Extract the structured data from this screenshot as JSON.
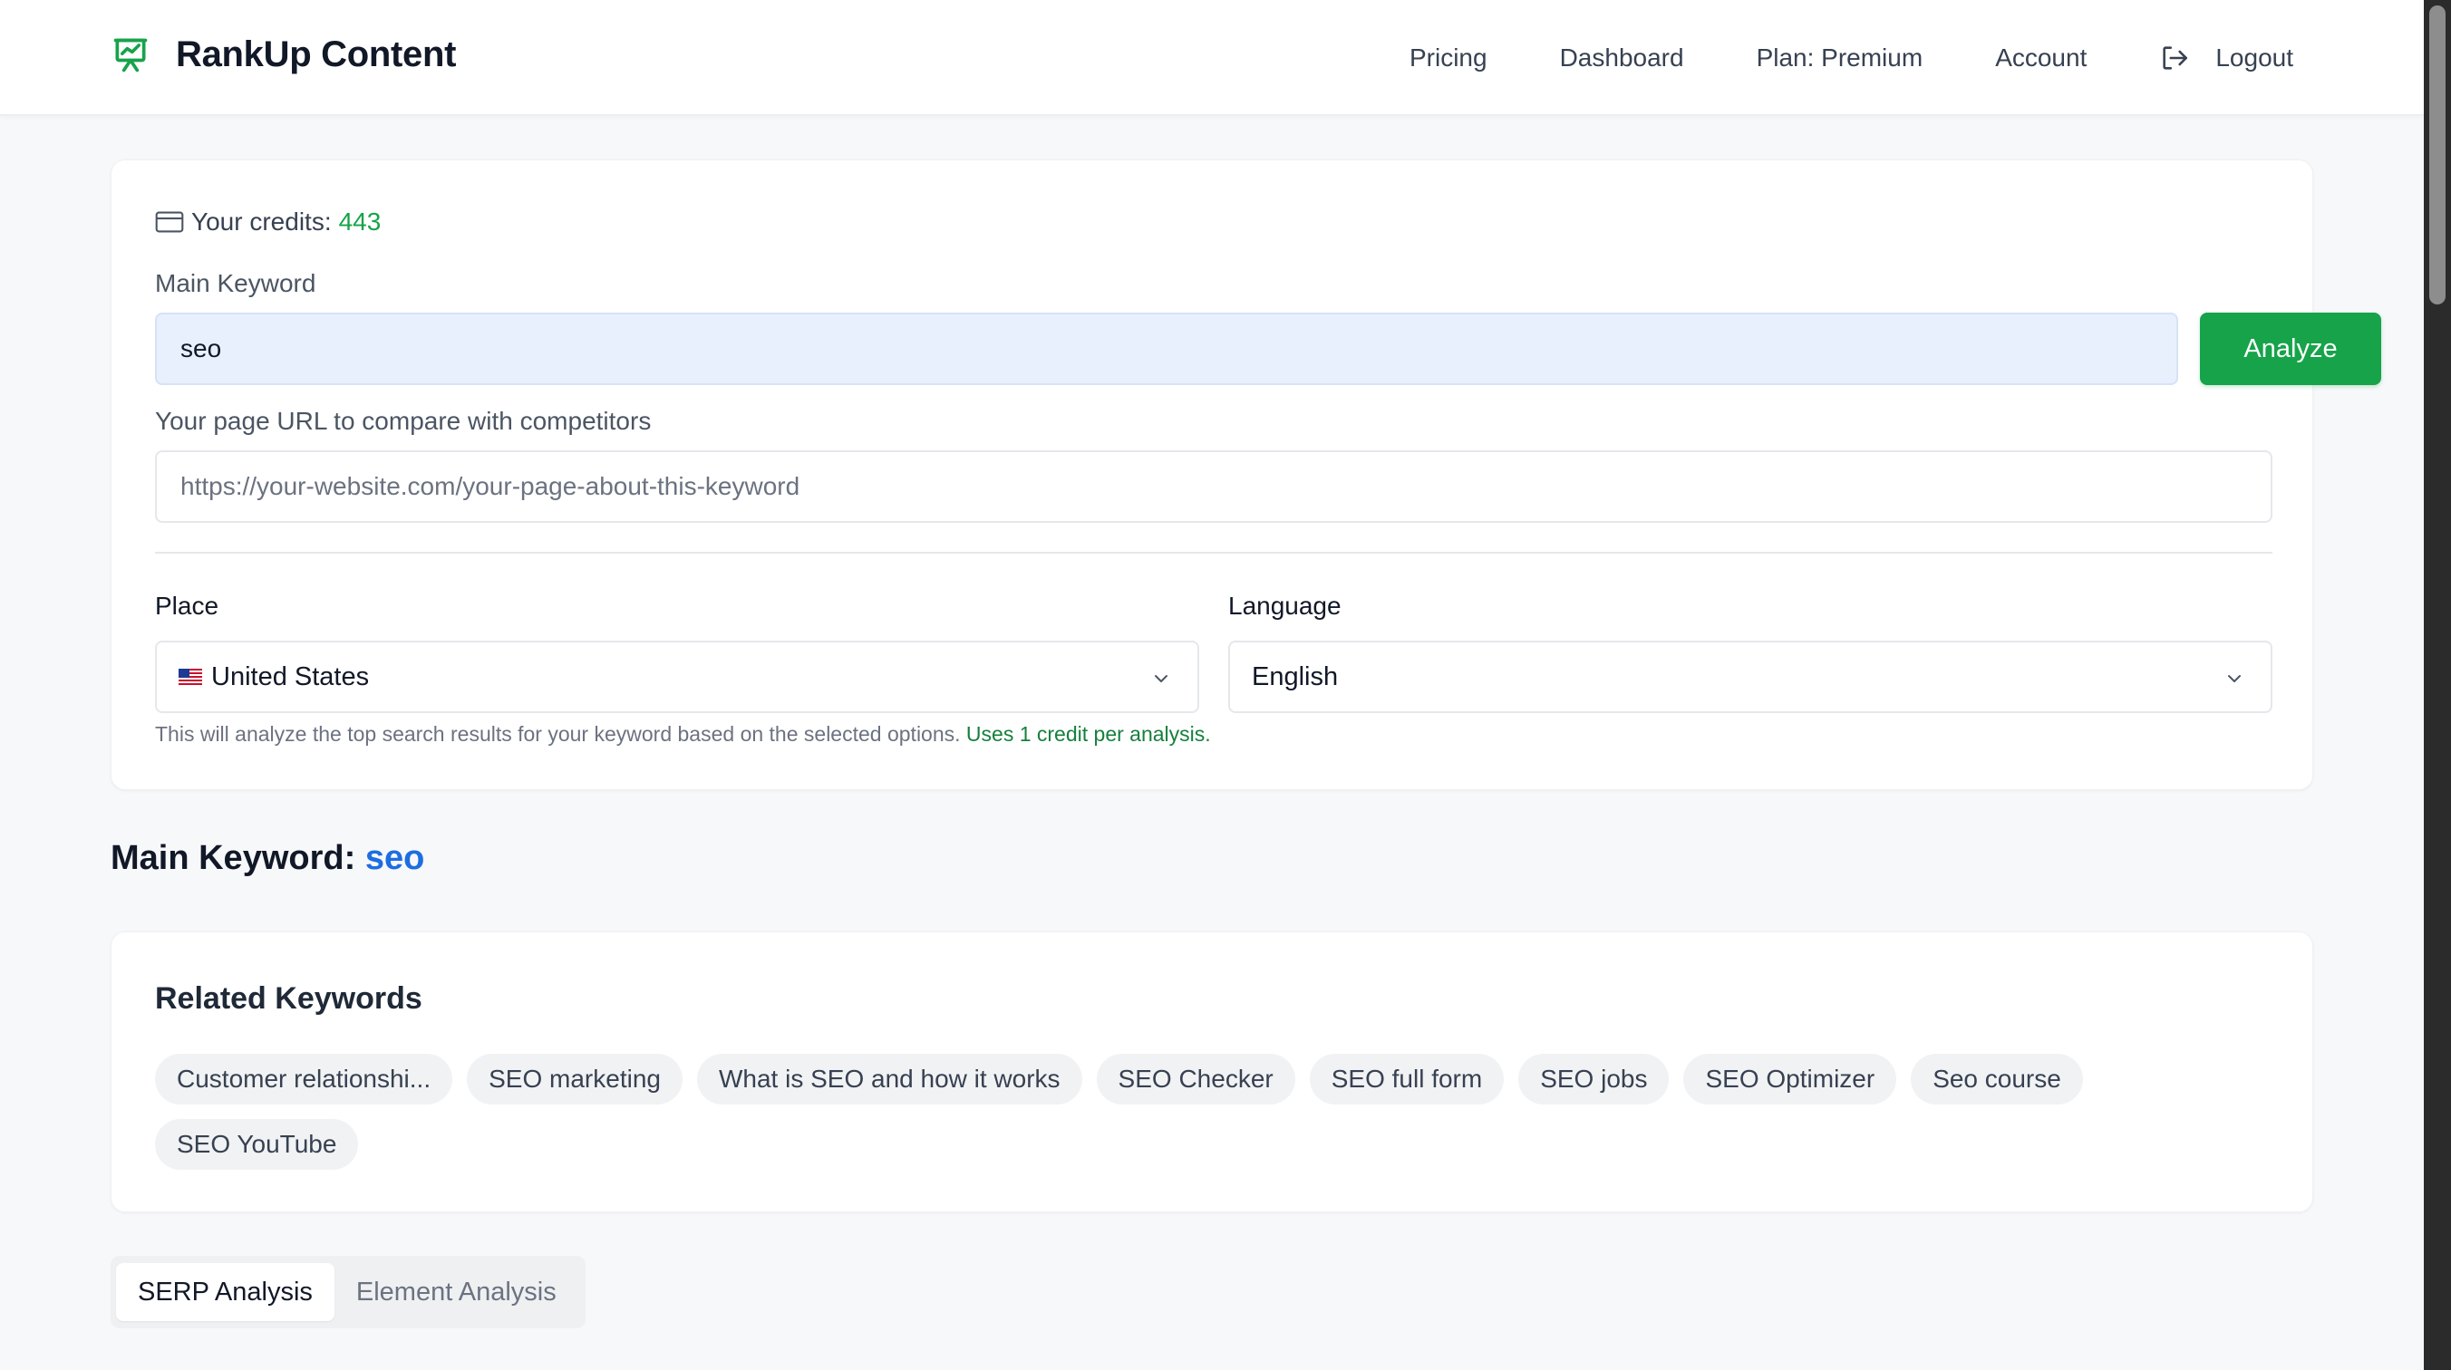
{
  "header": {
    "brand": "RankUp Content",
    "nav": {
      "pricing": "Pricing",
      "dashboard": "Dashboard",
      "plan": "Plan: Premium",
      "account": "Account",
      "logout": "Logout"
    },
    "brand_color": "#16a34a"
  },
  "form": {
    "credits_label": "Your credits:",
    "credits_value": "443",
    "keyword_label": "Main Keyword",
    "keyword_value": "seo",
    "analyze_label": "Analyze",
    "url_label": "Your page URL to compare with competitors",
    "url_placeholder": "https://your-website.com/your-page-about-this-keyword",
    "place_label": "Place",
    "place_value": "United States",
    "place_icon": "us-flag-icon",
    "language_label": "Language",
    "language_value": "English",
    "help_text": "This will analyze the top search results for your keyword based on the selected options.",
    "help_accent": "Uses 1 credit per analysis."
  },
  "main_keyword": {
    "label": "Main Keyword:",
    "value": "seo"
  },
  "related": {
    "title": "Related Keywords",
    "keywords": [
      "Customer relationshi...",
      "SEO marketing",
      "What is SEO and how it works",
      "SEO Checker",
      "SEO full form",
      "SEO jobs",
      "SEO Optimizer",
      "Seo course",
      "SEO YouTube"
    ]
  },
  "tabs": [
    {
      "label": "SERP Analysis",
      "active": true
    },
    {
      "label": "Element Analysis",
      "active": false
    }
  ],
  "colors": {
    "accent_green": "#16a34a",
    "accent_blue": "#1d6ee0",
    "input_highlight": "#e8f0fe"
  }
}
